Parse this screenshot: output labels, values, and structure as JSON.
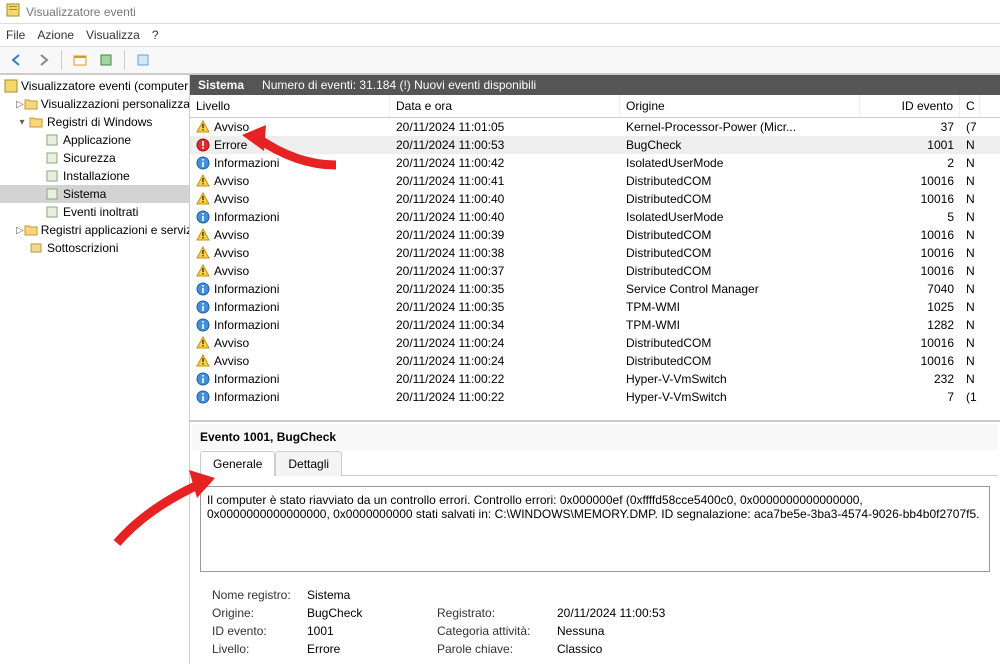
{
  "title": "Visualizzatore eventi",
  "menu": {
    "file": "File",
    "action": "Azione",
    "view": "Visualizza",
    "help": "?"
  },
  "tree": {
    "root": "Visualizzatore eventi (computer l",
    "custom_views": "Visualizzazioni personalizzate",
    "windows_logs": "Registri di Windows",
    "application": "Applicazione",
    "security": "Sicurezza",
    "installation": "Installazione",
    "system": "Sistema",
    "forwarded": "Eventi inoltrati",
    "app_services": "Registri applicazioni e servizi",
    "subscriptions": "Sottoscrizioni"
  },
  "header": {
    "name": "Sistema",
    "count": "Numero di eventi: 31.184 (!) Nuovi eventi disponibili"
  },
  "columns": {
    "level": "Livello",
    "date": "Data e ora",
    "origin": "Origine",
    "id": "ID evento",
    "cat": "C"
  },
  "level_labels": {
    "warn": "Avviso",
    "error": "Errore",
    "info": "Informazioni"
  },
  "events": [
    {
      "level": "warn",
      "date": "20/11/2024 11:01:05",
      "origin": "Kernel-Processor-Power (Micr...",
      "id": "37",
      "cat": "(7"
    },
    {
      "level": "error",
      "date": "20/11/2024 11:00:53",
      "origin": "BugCheck",
      "id": "1001",
      "cat": "N",
      "selected": true
    },
    {
      "level": "info",
      "date": "20/11/2024 11:00:42",
      "origin": "IsolatedUserMode",
      "id": "2",
      "cat": "N"
    },
    {
      "level": "warn",
      "date": "20/11/2024 11:00:41",
      "origin": "DistributedCOM",
      "id": "10016",
      "cat": "N"
    },
    {
      "level": "warn",
      "date": "20/11/2024 11:00:40",
      "origin": "DistributedCOM",
      "id": "10016",
      "cat": "N"
    },
    {
      "level": "info",
      "date": "20/11/2024 11:00:40",
      "origin": "IsolatedUserMode",
      "id": "5",
      "cat": "N"
    },
    {
      "level": "warn",
      "date": "20/11/2024 11:00:39",
      "origin": "DistributedCOM",
      "id": "10016",
      "cat": "N"
    },
    {
      "level": "warn",
      "date": "20/11/2024 11:00:38",
      "origin": "DistributedCOM",
      "id": "10016",
      "cat": "N"
    },
    {
      "level": "warn",
      "date": "20/11/2024 11:00:37",
      "origin": "DistributedCOM",
      "id": "10016",
      "cat": "N"
    },
    {
      "level": "info",
      "date": "20/11/2024 11:00:35",
      "origin": "Service Control Manager",
      "id": "7040",
      "cat": "N"
    },
    {
      "level": "info",
      "date": "20/11/2024 11:00:35",
      "origin": "TPM-WMI",
      "id": "1025",
      "cat": "N"
    },
    {
      "level": "info",
      "date": "20/11/2024 11:00:34",
      "origin": "TPM-WMI",
      "id": "1282",
      "cat": "N"
    },
    {
      "level": "warn",
      "date": "20/11/2024 11:00:24",
      "origin": "DistributedCOM",
      "id": "10016",
      "cat": "N"
    },
    {
      "level": "warn",
      "date": "20/11/2024 11:00:24",
      "origin": "DistributedCOM",
      "id": "10016",
      "cat": "N"
    },
    {
      "level": "info",
      "date": "20/11/2024 11:00:22",
      "origin": "Hyper-V-VmSwitch",
      "id": "232",
      "cat": "N"
    },
    {
      "level": "info",
      "date": "20/11/2024 11:00:22",
      "origin": "Hyper-V-VmSwitch",
      "id": "7",
      "cat": "(1"
    }
  ],
  "detail": {
    "title": "Evento 1001, BugCheck",
    "tab_general": "Generale",
    "tab_details": "Dettagli",
    "message": "Il computer è stato riavviato da un controllo errori. Controllo errori: 0x000000ef (0xffffd58cce5400c0, 0x0000000000000000, 0x0000000000000000, 0x0000000000 stati salvati in: C:\\WINDOWS\\MEMORY.DMP. ID segnalazione: aca7be5e-3ba3-4574-9026-bb4b0f2707f5.",
    "labels": {
      "log_name": "Nome registro:",
      "origin": "Origine:",
      "event_id": "ID evento:",
      "level": "Livello:",
      "registered": "Registrato:",
      "category": "Categoria attività:",
      "keywords": "Parole chiave:"
    },
    "values": {
      "log_name": "Sistema",
      "origin": "BugCheck",
      "event_id": "1001",
      "level": "Errore",
      "registered": "20/11/2024 11:00:53",
      "category": "Nessuna",
      "keywords": "Classico"
    }
  }
}
